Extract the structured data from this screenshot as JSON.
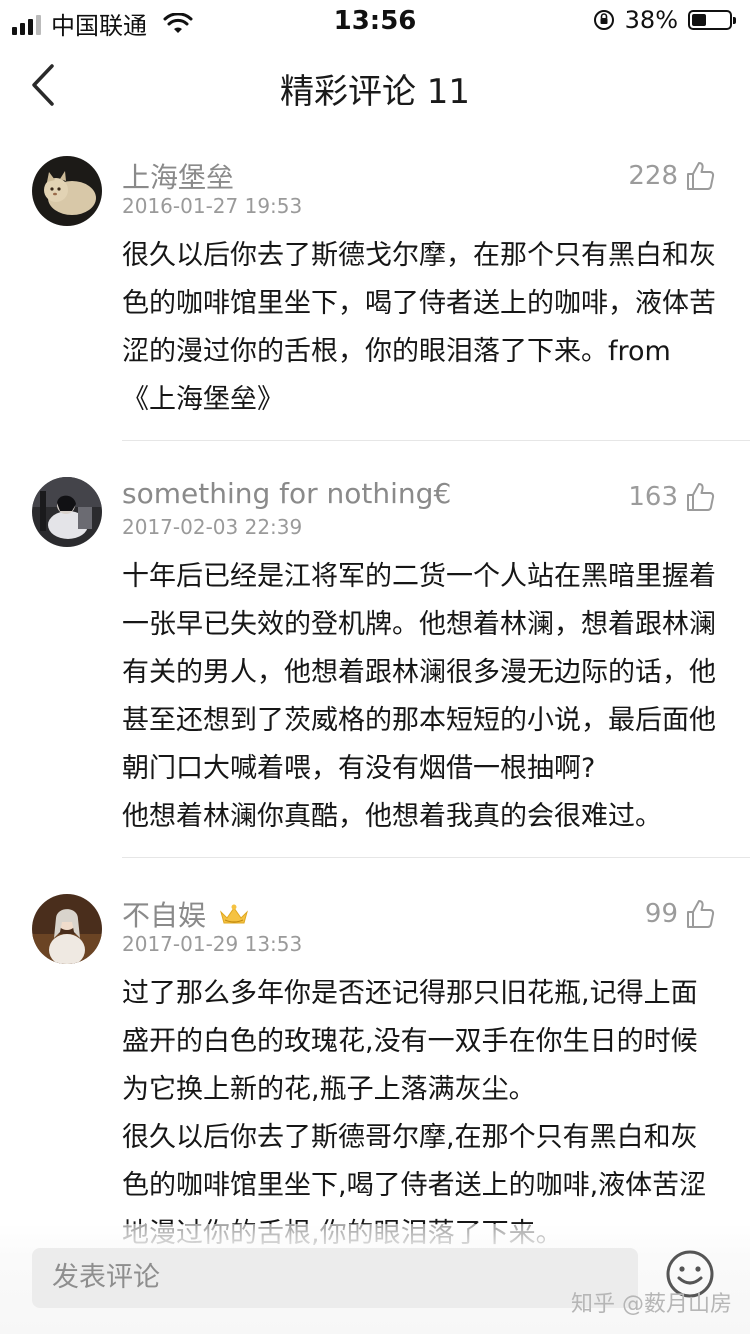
{
  "status_bar": {
    "carrier": "中国联通",
    "time": "13:56",
    "battery": "38%",
    "battery_level": 0.38
  },
  "nav": {
    "back_icon": "chevron-left-icon",
    "title": "精彩评论 11"
  },
  "comments": [
    {
      "name": "上海堡垒",
      "time": "2016-01-27 19:53",
      "likes": "228",
      "text": "很久以后你去了斯德戈尔摩，在那个只有黑白和灰色的咖啡馆里坐下，喝了侍者送上的咖啡，液体苦涩的漫过你的舌根，你的眼泪落了下来。from《上海堡垒》"
    },
    {
      "name": "something for nothing€",
      "time": "2017-02-03 22:39",
      "likes": "163",
      "text": "十年后已经是江将军的二货一个人站在黑暗里握着一张早已失效的登机牌。他想着林澜，想着跟林澜有关的男人，他想着跟林澜很多漫无边际的话，他甚至还想到了茨威格的那本短短的小说，最后面他朝门口大喊着喂，有没有烟借一根抽啊?\n他想着林澜你真酷，他想着我真的会很难过。"
    },
    {
      "name": "不自娱",
      "time": "2017-01-29 13:53",
      "likes": "99",
      "badge_icon": "crown-badge-icon",
      "text": "过了那么多年你是否还记得那只旧花瓶,记得上面盛开的白色的玫瑰花,没有一双手在你生日的时候为它换上新的花,瓶子上落满灰尘。\n很久以后你去了斯德哥尔摩,在那个只有黑白和灰色的咖啡馆里坐下,喝了侍者送上的咖啡,液体苦涩地漫过你的舌根,你的眼泪落了下来。"
    }
  ],
  "composer": {
    "placeholder": "发表评论",
    "emoji_icon": "emoji-face-icon"
  },
  "watermark": "知乎 @薮月山房",
  "colors": {
    "name": "#8a8a8a",
    "time": "#9a9a9a",
    "text": "#161616",
    "input_bg": "#ececec"
  }
}
